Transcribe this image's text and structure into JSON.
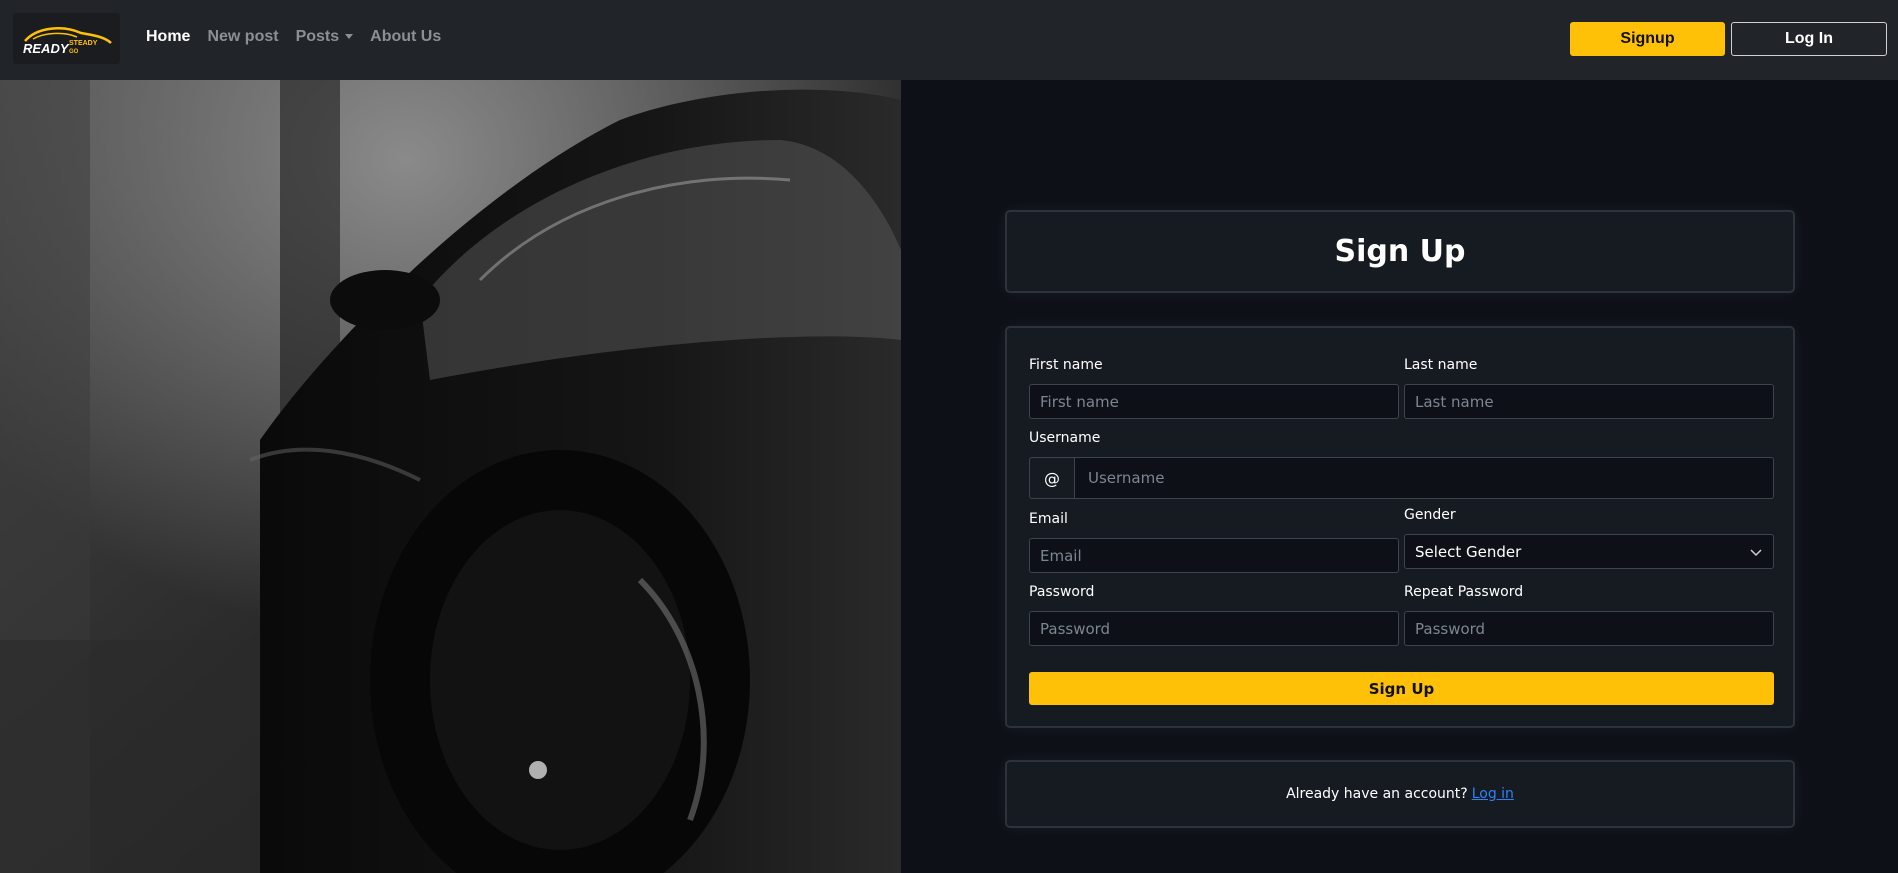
{
  "brand": {
    "logo_text": "READY",
    "logo_sub": "STEADY GO",
    "accent": "#ffc107"
  },
  "nav": {
    "home": "Home",
    "new_post": "New post",
    "posts": "Posts",
    "about": "About Us",
    "signup": "Signup",
    "login": "Log In"
  },
  "hero": {
    "icon": "car-photo"
  },
  "form": {
    "title": "Sign Up",
    "first_name_label": "First name",
    "first_name_placeholder": "First name",
    "last_name_label": "Last name",
    "last_name_placeholder": "Last name",
    "username_label": "Username",
    "username_prefix": "@",
    "username_placeholder": "Username",
    "email_label": "Email",
    "email_placeholder": "Email",
    "gender_label": "Gender",
    "gender_value": "Select Gender",
    "password_label": "Password",
    "password_placeholder": "Password",
    "repeat_label": "Repeat Password",
    "repeat_placeholder": "Password",
    "submit": "Sign Up"
  },
  "footer": {
    "text": "Already have an account?",
    "link": "Log in"
  }
}
